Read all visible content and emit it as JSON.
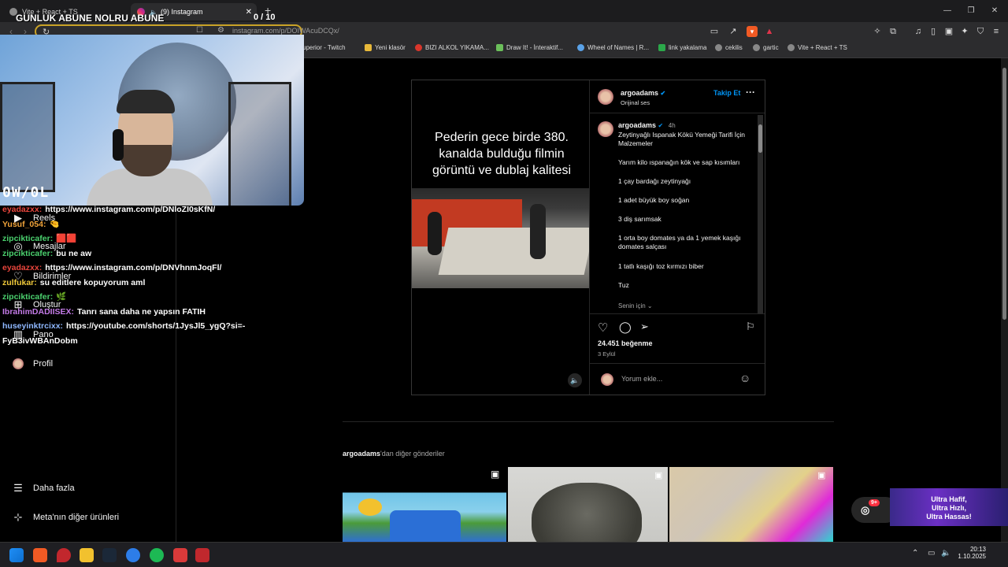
{
  "stream_overlay": {
    "title": "GUNLUK ABUNE NOLRU ABUNE",
    "counter": "0  / 10",
    "cam_logo": "0W/0L"
  },
  "browser": {
    "tabs": [
      {
        "label": "Vite + React + TS",
        "active": false
      },
      {
        "label": "(9) Instagram",
        "active": true
      }
    ],
    "url": "instagram.com/p/DOIWAcuDCQx/",
    "bookmarks": [
      "superior - Twitch",
      "Yeni klasör",
      "BIZI ALKOL YIKAMA...",
      "Draw It! - İnteraktif...",
      "Wheel of Names | R...",
      "link yakalama",
      "cekilis",
      "gartic",
      "Vite + React + TS"
    ]
  },
  "sidebar": {
    "items": [
      {
        "icon": "reels-icon",
        "label": "Reels"
      },
      {
        "icon": "messenger-icon",
        "label": "Mesajlar"
      },
      {
        "icon": "heart-icon",
        "label": "Bildirimler"
      },
      {
        "icon": "plus-icon",
        "label": "Oluştur"
      },
      {
        "icon": "chart-icon",
        "label": "Pano"
      },
      {
        "icon": "profile-avatar",
        "label": "Profil"
      }
    ],
    "more": "Daha fazla",
    "meta": "Meta'nın diğer ürünleri"
  },
  "chat": [
    {
      "user": "eyadazxx:",
      "msg": "https://www.instagram.com/p/DNloZI0sKfN/",
      "color": "#e8453c"
    },
    {
      "user": "Yusuf_054:",
      "msg": "🤏",
      "color": "#f0a33a"
    },
    {
      "user": "zipcikticafer:",
      "msg": "🟥🟥",
      "color": "#4bd16e"
    },
    {
      "user": "zipcikticafer:",
      "msg": "bu ne aw",
      "color": "#4bd16e"
    },
    {
      "user": "eyadazxx:",
      "msg": "https://www.instagram.com/p/DNVhnmJoqFl/",
      "color": "#e8453c"
    },
    {
      "user": "zulfukar:",
      "msg": "su editlere kopuyorum aml",
      "color": "#f0c93a"
    },
    {
      "user": "zipcikticafer:",
      "msg": "🌿",
      "color": "#4bd16e"
    },
    {
      "user": "IbrahimDADIISEX:",
      "msg": "Tanrı sana daha ne yapsın FATIH",
      "color": "#c47be8"
    },
    {
      "user": "huseyinktrcixx:",
      "msg": "https://youtube.com/shorts/1JysJl5_ygQ?si=-",
      "color": "#8fb8ff"
    },
    {
      "user": "",
      "msg": "FyB3ivWBAnDobm",
      "color": "#ffffff"
    }
  ],
  "post": {
    "media_caption": "Pederin gece birde 380. kanalda bulduğu filmin görüntü ve dublaj kalitesi",
    "author": "argoadams",
    "audio": "Orijinal ses",
    "follow": "Takip Et",
    "caption_time": "4h",
    "caption_title": "Zeytinyağlı Ispanak Kökü Yemeği Tarifi İçin Malzemeler",
    "ingredients": [
      "Yarım kilo ıspanağın kök ve sap kısımları",
      "1 çay bardağı zeytinyağı",
      "1 adet büyük boy soğan",
      "3 diş sarımsak",
      "1 orta boy domates ya da 1 yemek kaşığı domates salçası",
      "1 tatlı kaşığı toz kırmızı biber",
      "Tuz"
    ],
    "for_you": "Senin için",
    "likes": "24.451 beğenme",
    "date": "3 Eylül",
    "comment_placeholder": "Yorum ekle..."
  },
  "more_posts": {
    "author": "argoadams",
    "suffix": "'dan diğer gönderiler"
  },
  "ad": {
    "lines": [
      "Ultra Hafif,",
      "Ultra Hızlı,",
      "Ultra Hassas!"
    ]
  },
  "messages_badge": "9+",
  "taskbar": {
    "time": "20:13",
    "date": "1.10.2025"
  },
  "colors": {
    "accent_blue": "#0095f6",
    "background": "#000000",
    "border": "#262626"
  }
}
